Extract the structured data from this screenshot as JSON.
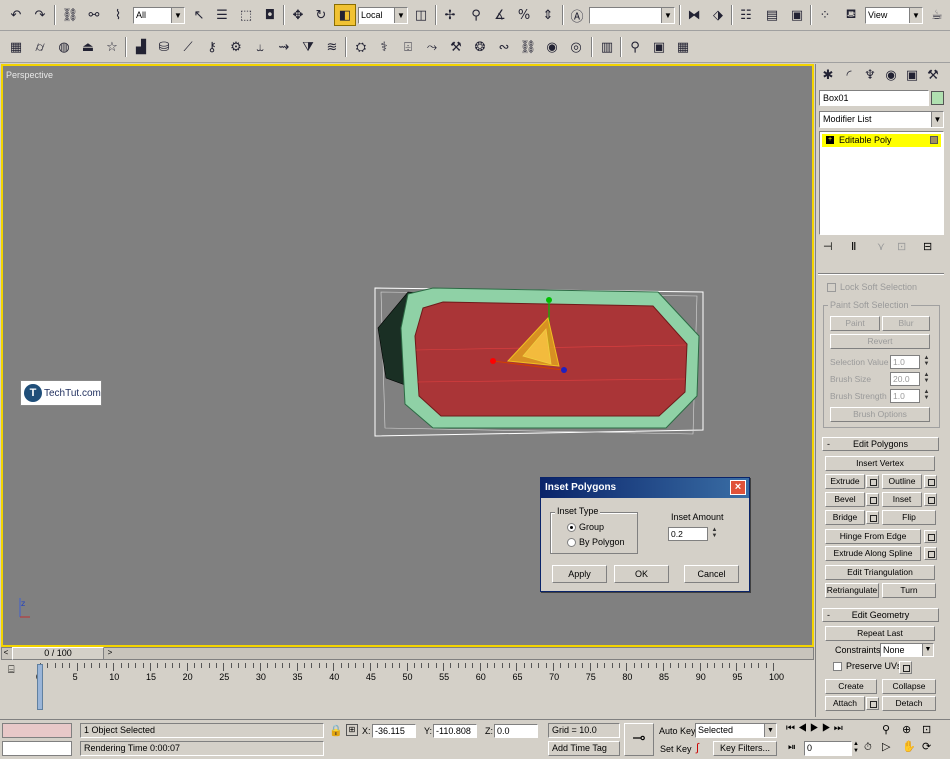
{
  "toolbar_main": {
    "selection_filter": "All",
    "ref_coord": "Local",
    "named_selection": "",
    "view_dropdown": "View"
  },
  "viewport": {
    "label": "Perspective",
    "watermark": "TechTut.com"
  },
  "command_panel": {
    "object_name": "Box01",
    "object_color": "#b0e0b0",
    "modifier_list": "Modifier List",
    "stack_items": [
      "Editable Poly"
    ],
    "soft_selection": {
      "lock_soft_selection": "Lock Soft Selection",
      "paint_group": "Paint Soft Selection",
      "paint": "Paint",
      "blur": "Blur",
      "revert": "Revert",
      "selection_value_label": "Selection Value",
      "selection_value": "1.0",
      "brush_size_label": "Brush Size",
      "brush_size": "20.0",
      "brush_strength_label": "Brush Strength",
      "brush_strength": "1.0",
      "brush_options": "Brush Options"
    },
    "edit_polygons": {
      "title": "Edit Polygons",
      "insert_vertex": "Insert Vertex",
      "extrude": "Extrude",
      "outline": "Outline",
      "bevel": "Bevel",
      "inset": "Inset",
      "bridge": "Bridge",
      "flip": "Flip",
      "hinge_from_edge": "Hinge From Edge",
      "extrude_along_spline": "Extrude Along Spline",
      "edit_triangulation": "Edit Triangulation",
      "retriangulate": "Retriangulate",
      "turn": "Turn"
    },
    "edit_geometry": {
      "title": "Edit Geometry",
      "repeat_last": "Repeat Last",
      "constraints_label": "Constraints:",
      "constraints_value": "None",
      "preserve_uvs": "Preserve UVs",
      "create": "Create",
      "collapse": "Collapse",
      "attach": "Attach",
      "detach": "Detach"
    }
  },
  "dialog": {
    "title": "Inset Polygons",
    "inset_type_label": "Inset Type",
    "option_group": "Group",
    "option_by_polygon": "By Polygon",
    "inset_amount_label": "Inset Amount",
    "inset_amount": "0.2",
    "apply": "Apply",
    "ok": "OK",
    "cancel": "Cancel"
  },
  "timeline": {
    "frame_counter": "0 / 100",
    "ticks": [
      "0",
      "5",
      "10",
      "15",
      "20",
      "25",
      "30",
      "35",
      "40",
      "45",
      "50",
      "55",
      "60",
      "65",
      "70",
      "75",
      "80",
      "85",
      "90",
      "95",
      "100"
    ]
  },
  "status": {
    "selection_info": "1 Object Selected",
    "render_time": "Rendering Time  0:00:07",
    "x_label": "X:",
    "x_value": "-36.115",
    "y_label": "Y:",
    "y_value": "-110.808",
    "z_label": "Z:",
    "z_value": "0.0",
    "grid": "Grid = 10.0",
    "add_time_tag": "Add Time Tag",
    "auto_key": "Auto Key",
    "auto_key_mode": "Selected",
    "set_key": "Set Key",
    "key_filters": "Key Filters...",
    "current_frame": "0"
  }
}
